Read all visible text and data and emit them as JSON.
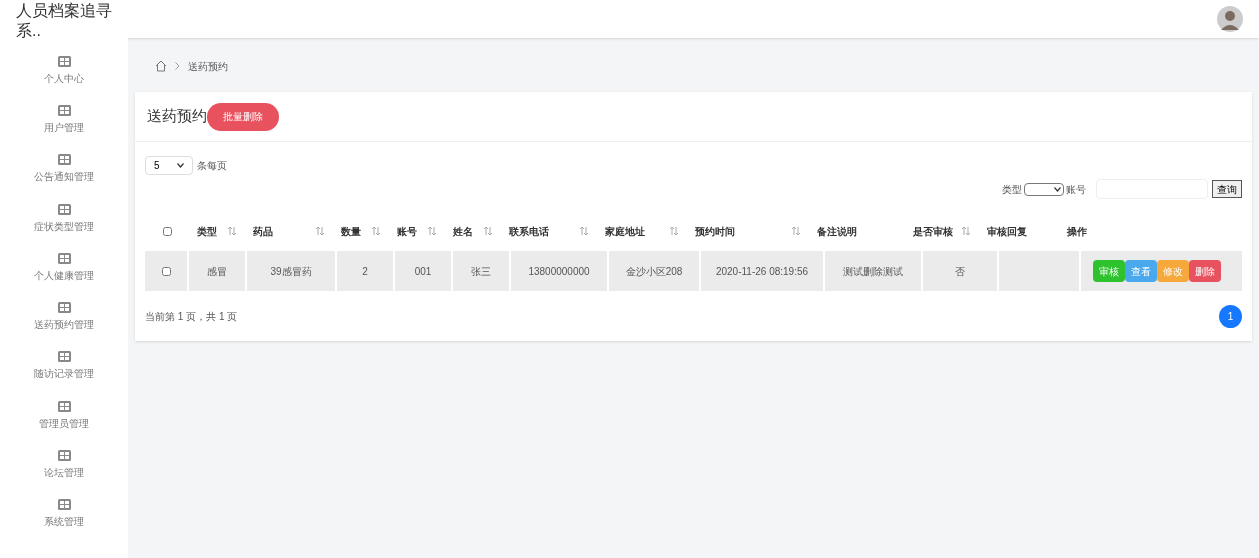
{
  "header": {
    "title": "人员档案追寻系.."
  },
  "sidebar": {
    "items": [
      {
        "label": "个人中心"
      },
      {
        "label": "用户管理"
      },
      {
        "label": "公告通知管理"
      },
      {
        "label": "症状类型管理"
      },
      {
        "label": "个人健康管理"
      },
      {
        "label": "送药预约管理"
      },
      {
        "label": "随访记录管理"
      },
      {
        "label": "管理员管理"
      },
      {
        "label": "论坛管理"
      },
      {
        "label": "系统管理"
      }
    ]
  },
  "breadcrumb": {
    "current": "送药预约"
  },
  "panel": {
    "title": "送药预约",
    "batch_delete": "批量删除"
  },
  "page_size": {
    "value": "5",
    "label": "条每页"
  },
  "search": {
    "type_label": "类型",
    "account_label": "账号",
    "button": "查询"
  },
  "table": {
    "select_all_checked": false,
    "columns": [
      {
        "label": "类型",
        "sortable": true
      },
      {
        "label": "药品",
        "sortable": true
      },
      {
        "label": "数量",
        "sortable": true
      },
      {
        "label": "账号",
        "sortable": true
      },
      {
        "label": "姓名",
        "sortable": true
      },
      {
        "label": "联系电话",
        "sortable": true
      },
      {
        "label": "家庭地址",
        "sortable": true
      },
      {
        "label": "预约时间",
        "sortable": true
      },
      {
        "label": "备注说明",
        "sortable": false
      },
      {
        "label": "是否审核",
        "sortable": true
      },
      {
        "label": "审核回复",
        "sortable": false
      },
      {
        "label": "操作",
        "sortable": false
      }
    ],
    "rows": [
      {
        "checked": false,
        "cells": [
          "感冒",
          "39感冒药",
          "2",
          "001",
          "张三",
          "13800000000",
          "金沙小区208",
          "2020-11-26 08:19:56",
          "测试删除测试",
          "否",
          ""
        ],
        "actions": [
          {
            "label": "审核",
            "color": "#2fc22f"
          },
          {
            "label": "查看",
            "color": "#4aa8ec"
          },
          {
            "label": "修改",
            "color": "#f7a83a"
          },
          {
            "label": "删除",
            "color": "#e8515e"
          }
        ]
      }
    ]
  },
  "footer": {
    "info": "当前第 1 页，共 1 页",
    "pages": [
      {
        "label": "1",
        "selected": true
      }
    ]
  }
}
